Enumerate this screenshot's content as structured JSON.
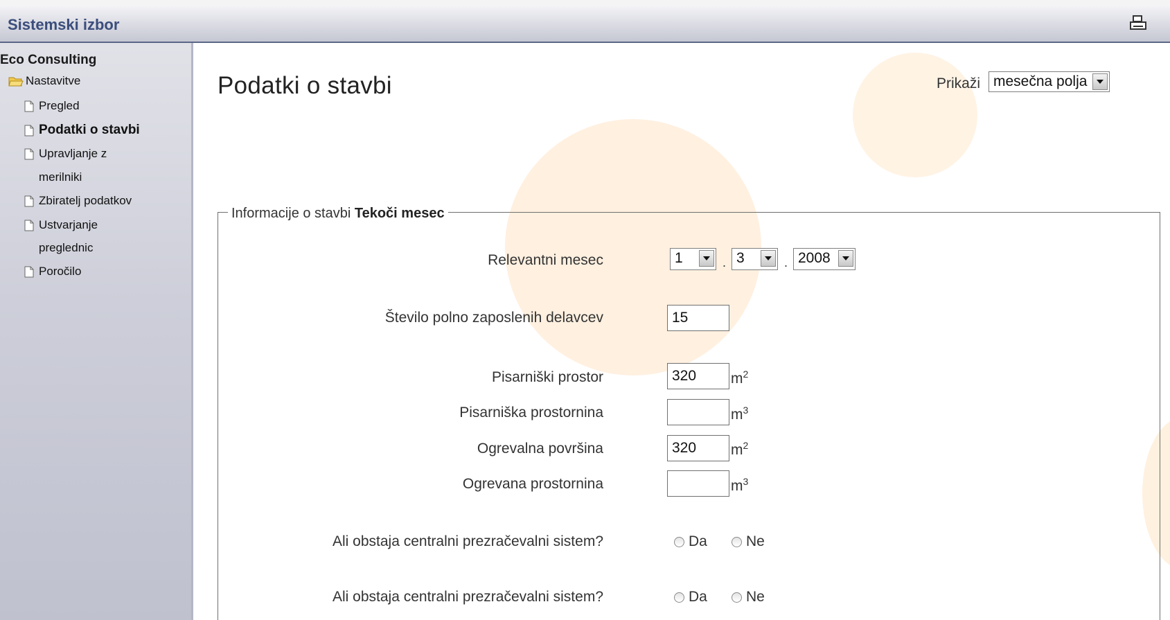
{
  "header": {
    "title": "Sistemski izbor",
    "print_icon": "printer-icon"
  },
  "sidebar": {
    "company": "Eco Consulting",
    "folder": "Nastavitve",
    "items": [
      {
        "label": "Pregled"
      },
      {
        "label": "Podatki o stavbi",
        "active": true
      },
      {
        "label": "Upravljanje z",
        "label_cont": "merilniki"
      },
      {
        "label": "Zbiratelj podatkov"
      },
      {
        "label": "Ustvarjanje",
        "label_cont": "preglednic"
      },
      {
        "label": "Poročilo"
      }
    ]
  },
  "main": {
    "title": "Podatki o stavbi",
    "show_label": "Prikaži",
    "show_value": "mesečna polja",
    "fieldset": {
      "legend_prefix": "Informacije o stavbi",
      "legend_bold": "Tekoči mesec"
    },
    "relevant_month": {
      "label": "Relevantni mesec",
      "day": "1",
      "month": "3",
      "year": "2008"
    },
    "employees": {
      "label": "Število polno zaposlenih delavcev",
      "value": "15"
    },
    "office_area": {
      "label": "Pisarniški prostor",
      "value": "320",
      "unit": "m",
      "exp": "2"
    },
    "office_volume": {
      "label": "Pisarniška prostornina",
      "value": "",
      "unit": "m",
      "exp": "3"
    },
    "heated_area": {
      "label": "Ogrevalna površina",
      "value": "320",
      "unit": "m",
      "exp": "2"
    },
    "heated_volume": {
      "label": "Ogrevana prostornina",
      "value": "",
      "unit": "m",
      "exp": "3"
    },
    "ventilation_1": {
      "question": "Ali obstaja centralni prezračevalni sistem?",
      "yes": "Da",
      "no": "Ne"
    },
    "ventilation_2": {
      "question": "Ali obstaja centralni prezračevalni sistem?",
      "yes": "Da",
      "no": "Ne"
    }
  },
  "colors": {
    "header_text": "#3a4d7c",
    "header_line": "#5a6686",
    "sidebar_bg": "#cdced9",
    "deco_orange": "#fdebd6"
  }
}
